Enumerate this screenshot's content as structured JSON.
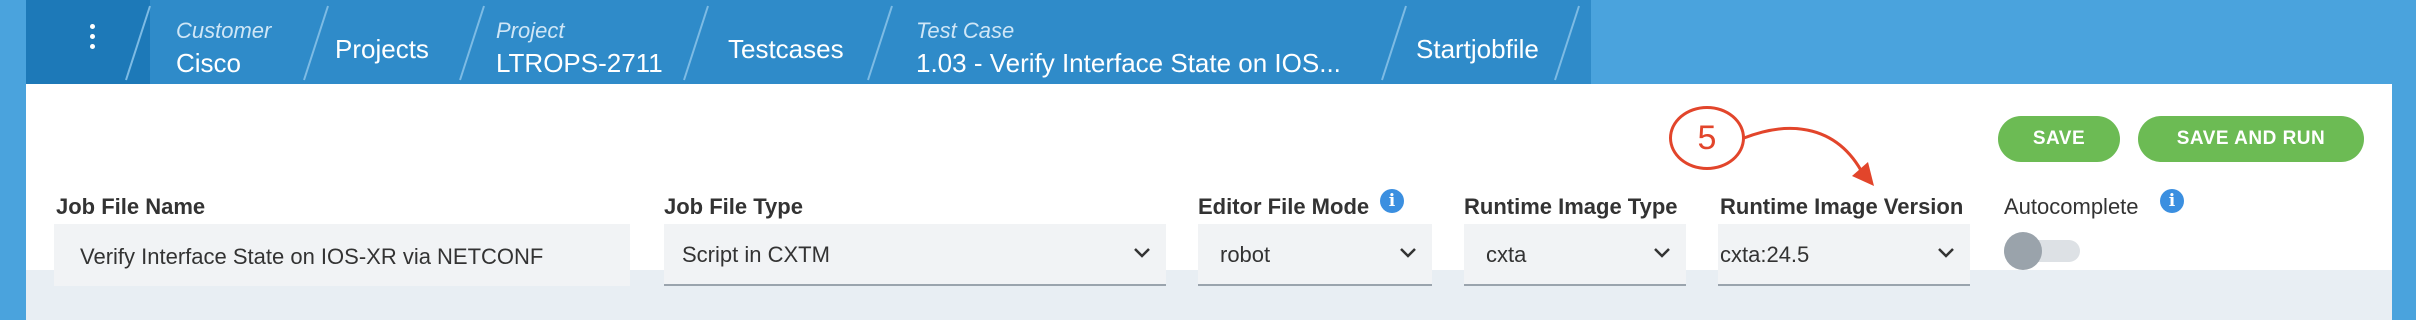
{
  "breadcrumb": {
    "menu_icon": "more-vertical-icon",
    "customer": {
      "sub": "Customer",
      "main": "Cisco"
    },
    "projects": {
      "label": "Projects"
    },
    "project": {
      "sub": "Project",
      "main": "LTROPS-2711"
    },
    "testcases": {
      "label": "Testcases"
    },
    "testcase": {
      "sub": "Test Case",
      "main": "1.03 - Verify Interface State on IOS..."
    },
    "startjobfile": {
      "label": "Startjobfile"
    }
  },
  "toolbar": {
    "save_label": "SAVE",
    "save_and_run_label": "SAVE AND RUN"
  },
  "form": {
    "job_file_name": {
      "label": "Job File Name",
      "value": "Verify Interface State on IOS-XR via NETCONF"
    },
    "job_file_type": {
      "label": "Job File Type",
      "value": "Script in CXTM"
    },
    "editor_file_mode": {
      "label": "Editor File Mode",
      "value": "robot"
    },
    "runtime_image_type": {
      "label": "Runtime Image Type",
      "value": "cxta"
    },
    "runtime_image_version": {
      "label": "Runtime Image Version",
      "value": "cxta:24.5"
    },
    "autocomplete": {
      "label": "Autocomplete",
      "enabled": false
    }
  },
  "annotation": {
    "number": "5"
  },
  "colors": {
    "header_blue": "#2f8bc9",
    "accent_green": "#6cbb54",
    "annotation_red": "#e2452b",
    "info_blue": "#3b8fe0"
  }
}
